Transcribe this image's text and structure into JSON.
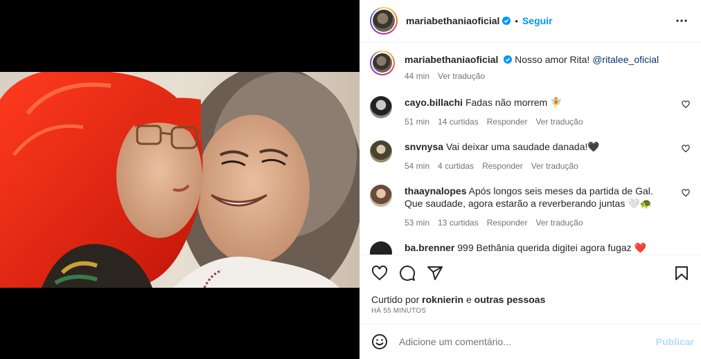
{
  "header": {
    "username": "mariabethaniaoficial",
    "separator": "•",
    "follow_label": "Seguir",
    "more_icon": "more-horizontal-icon"
  },
  "caption": {
    "username": "mariabethaniaoficial",
    "text": "Nosso amor Rita!",
    "mention": "@ritalee_oficial",
    "time": "44 min",
    "translate": "Ver tradução"
  },
  "comments": [
    {
      "username": "cayo.billachi",
      "text": "Fadas não morrem 🧚",
      "time": "51 min",
      "likes": "14 curtidas",
      "reply": "Responder",
      "translate": "Ver tradução"
    },
    {
      "username": "snvnysa",
      "text": "Vai deixar uma saudade danada!🖤",
      "time": "54 min",
      "likes": "4 curtidas",
      "reply": "Responder",
      "translate": "Ver tradução"
    },
    {
      "username": "thaaynalopes",
      "text": "Após longos seis meses da partida de Gal. Que saudade, agora estarão a reverberando juntas 🤍🐢",
      "time": "53 min",
      "likes": "13 curtidas",
      "reply": "Responder",
      "translate": "Ver tradução"
    },
    {
      "username": "ba.brenner",
      "text": "999 Bethânia querida digitei agora fugaz ❤️",
      "time": "",
      "likes": "",
      "reply": "",
      "translate": ""
    }
  ],
  "actions": {
    "liked_by_prefix": "Curtido por",
    "liked_by_user": "roknierin",
    "liked_by_join": "e",
    "liked_by_others": "outras pessoas",
    "time_ago": "HÁ 55 MINUTOS"
  },
  "add_comment": {
    "placeholder": "Adicione um comentário...",
    "publish_label": "Publicar"
  },
  "colors": {
    "accent": "#0095f6",
    "publish_disabled": "#b3dbff",
    "muted": "#737373",
    "verified": "#0095f6"
  }
}
